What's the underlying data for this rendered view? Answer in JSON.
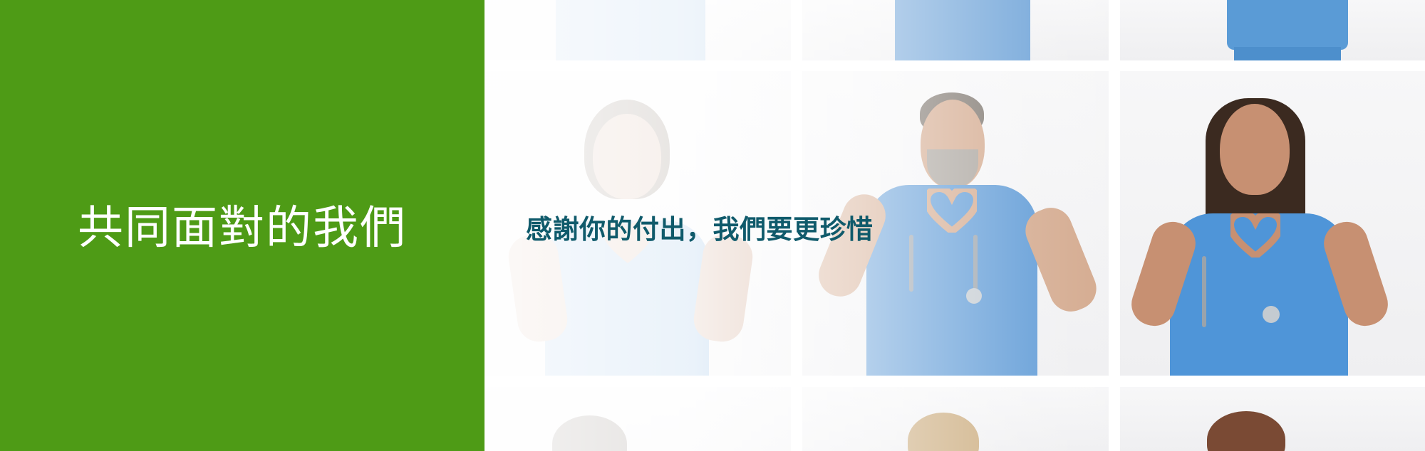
{
  "banner": {
    "left_title": "共同面對的我們",
    "tagline": "感謝你的付出，我們要更珍惜"
  },
  "colors": {
    "green_panel": "#4e9b16",
    "tagline_text": "#0f5a6b",
    "scrubs_blue": "#5a9bd6"
  },
  "photos": [
    {
      "subject": "nurse-top-left"
    },
    {
      "subject": "nurse-top-center"
    },
    {
      "subject": "nurse-top-right"
    },
    {
      "subject": "nurse-heart-hands-left"
    },
    {
      "subject": "doctor-heart-hands-center"
    },
    {
      "subject": "nurse-heart-hands-right"
    },
    {
      "subject": "nurse-bottom-left"
    },
    {
      "subject": "nurse-bottom-center"
    },
    {
      "subject": "nurse-bottom-right"
    }
  ]
}
